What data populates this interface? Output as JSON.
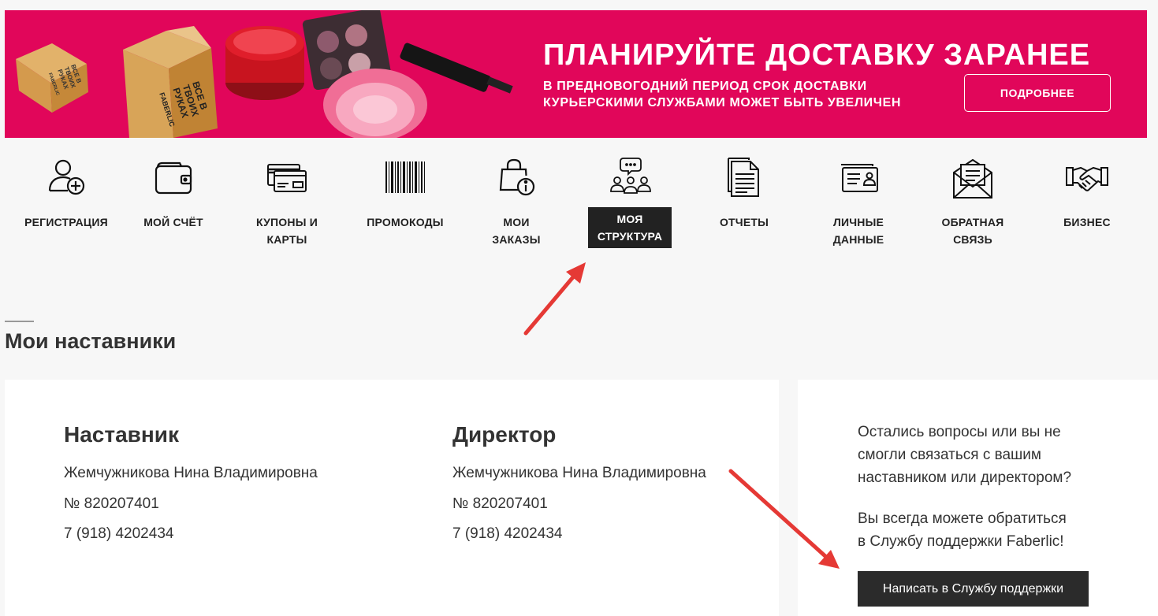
{
  "banner": {
    "title": "ПЛАНИРУЙТЕ ДОСТАВКУ ЗАРАНЕЕ",
    "text_line1": "В ПРЕДНОВОГОДНИЙ ПЕРИОД СРОК ДОСТАВКИ",
    "text_line2": "КУРЬЕРСКИМИ СЛУЖБАМИ МОЖЕТ БЫТЬ УВЕЛИЧЕН",
    "button_label": "ПОДРОБНЕЕ",
    "background_color": "#e1065a",
    "box_print": [
      "ВСЕ В",
      "ТВОИХ",
      "РУКАХ",
      "FABERLIC"
    ]
  },
  "nav": {
    "items": [
      {
        "line1": "РЕГИСТРАЦИЯ",
        "line2": "",
        "icon": "add-user-icon"
      },
      {
        "line1": "МОЙ СЧЁТ",
        "line2": "",
        "icon": "wallet-icon"
      },
      {
        "line1": "КУПОНЫ И",
        "line2": "КАРТЫ",
        "icon": "cards-icon"
      },
      {
        "line1": "ПРОМОКОДЫ",
        "line2": "",
        "icon": "barcode-icon"
      },
      {
        "line1": "МОИ",
        "line2": "ЗАКАЗЫ",
        "icon": "shopping-bag-info-icon"
      },
      {
        "line1": "МОЯ",
        "line2": "СТРУКТУРА",
        "icon": "team-chat-icon",
        "active": true
      },
      {
        "line1": "ОТЧЕТЫ",
        "line2": "",
        "icon": "document-icon"
      },
      {
        "line1": "ЛИЧНЫЕ",
        "line2": "ДАННЫЕ",
        "icon": "id-card-icon"
      },
      {
        "line1": "ОБРАТНАЯ",
        "line2": "СВЯЗЬ",
        "icon": "envelope-icon"
      },
      {
        "line1": "БИЗНЕС",
        "line2": "",
        "icon": "handshake-icon"
      }
    ]
  },
  "section_title": "Мои наставники",
  "mentor": {
    "heading": "Наставник",
    "name": "Жемчужникова Нина Владимировна",
    "number": "№ 820207401",
    "phone": "7 (918) 4202434"
  },
  "director": {
    "heading": "Директор",
    "name": "Жемчужникова Нина Владимировна",
    "number": "№ 820207401",
    "phone": "7 (918) 4202434"
  },
  "support": {
    "text1_line1": "Остались вопросы или вы не",
    "text1_line2": "смогли связаться с вашим",
    "text1_line3": "наставником или директором?",
    "text2_line1": "Вы всегда можете обратиться",
    "text2_line2": "в Службу поддержки Faberlic!",
    "button_label": "Написать в Службу поддержки"
  },
  "colors": {
    "accent": "#e1065a",
    "dark_button": "#2b2b2b",
    "annotation_arrow": "#e53935"
  }
}
